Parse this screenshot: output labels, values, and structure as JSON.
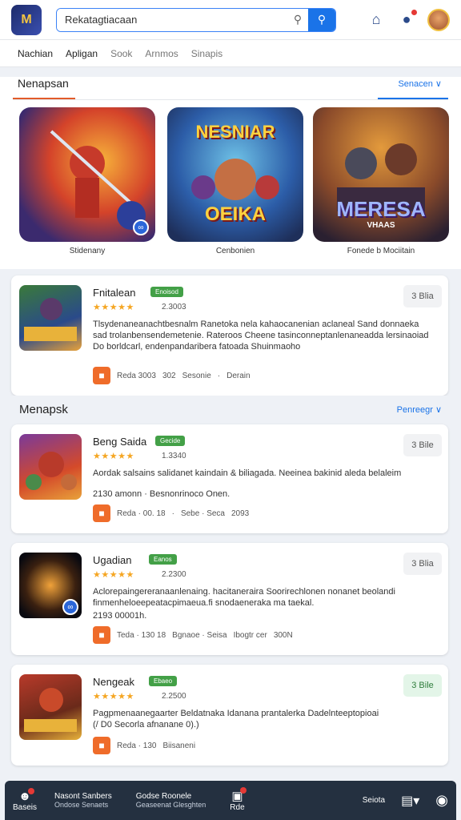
{
  "header": {
    "logo_text": "M",
    "search_value": "Rekatagtiacaan"
  },
  "nav": [
    "Nachian",
    "Apligan",
    "Sook",
    "Arnmos",
    "Sinapis"
  ],
  "featured": {
    "title": "Nenapsan",
    "more": "Senacen ∨",
    "tiles": [
      {
        "caption": "Stidenany",
        "art": ""
      },
      {
        "caption": "Cenbonien",
        "art_top": "NESNIAR",
        "art_bottom": "OEIKA"
      },
      {
        "caption": "Fonede b Mociitain",
        "art_top": "MERESA",
        "art_bottom": "VHAAS"
      }
    ]
  },
  "apps_top": [
    {
      "name": "Fnitalean",
      "tag": "Enoisod",
      "stars": "★★★★★",
      "rating": "2.3003",
      "desc": "Tlsydenaneanachtbesnalm Ranetoka nela kahaocanenian aclaneal Sand donnaeka sad trolanbensendemetenie. Rateroos Cheene tasinconneptanlenaneadda lersinaoiad Do borldcarl, endenpandaribera fatoada Shuinmaoho",
      "desc2": "",
      "get": "3 Blia",
      "get_green": false,
      "meta": [
        "Reda 3003",
        "302",
        "Sesonie",
        "·",
        "Derain"
      ],
      "thumb": "rpg"
    }
  ],
  "section2": {
    "title": "Menapsk",
    "more": "Penreegr ∨"
  },
  "apps": [
    {
      "name": "Beng Saida",
      "tag": "Gecide",
      "stars": "★★★★★",
      "rating": "1.3340",
      "desc": "Aordak salsains salidanet kaindain & biliagada. Neeinea bakinid aleda belaleim",
      "desc2": "2130 amonn · Besnonrinoco Onen.",
      "get": "3 Bile",
      "get_green": false,
      "meta": [
        "Reda · 00. 18",
        "·",
        "Sebe · Seca",
        "2093"
      ],
      "thumb": "hero"
    },
    {
      "name": "Ugadian",
      "tag": "Eanos",
      "stars": "★★★★★",
      "rating": "2.2300",
      "desc": "Aclorepaingereranaanlenaing. hacitaneraira Soorirechlonen nonanet beolandi finmenheloeepeatacpimaeua.fi snodaeneraka ma taekal.",
      "desc2": "2193 00001h.",
      "get": "3 Blia",
      "get_green": false,
      "meta": [
        "Teda · 130 18",
        "Bgnaoe · Seisa",
        "Ibogtr cer",
        "300N"
      ],
      "thumb": "dark"
    },
    {
      "name": "Nengeak",
      "tag": "Ebaeo",
      "stars": "★★★★★",
      "rating": "2.2500",
      "desc": "Pagpmenaanegaarter Beldatnaka Idanana prantalerka Dadelnteeptopioai",
      "desc2": "(/ D0 Secorla afnanane 0).)",
      "get": "3 Bile",
      "get_green": true,
      "meta": [
        "Reda · 130",
        "Biisaneni"
      ],
      "thumb": "fight"
    }
  ],
  "bottom": {
    "profile_label": "Baseis",
    "item1_l1": "Nasont Sanbers",
    "item1_l2": "Ondose Senaets",
    "item2_l1": "Godse Roonele",
    "item2_l2": "Geaseenat Glesghten",
    "item3_label": "Rde",
    "item4_label": "Seiota"
  }
}
